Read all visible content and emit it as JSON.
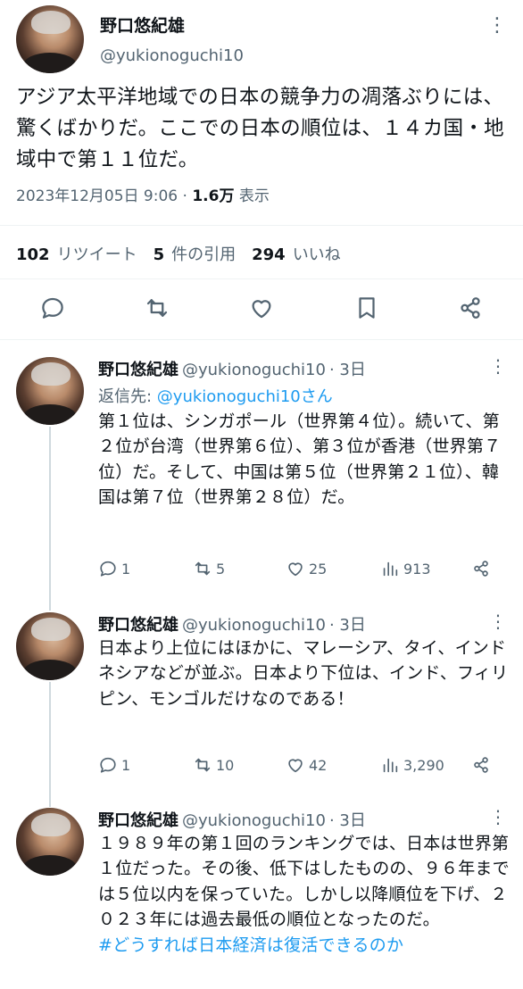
{
  "main": {
    "name": "野口悠紀雄",
    "handle": "@yukionoguchi10",
    "text": "アジア太平洋地域での日本の競争力の凋落ぶりには、驚くばかりだ。ここでの日本の順位は、１４カ国・地域中で第１１位だ。",
    "timestamp": "2023年12月05日 9:06",
    "separator": "·",
    "views_count": "1.6万",
    "views_label": "表示",
    "retweets": {
      "count": "102",
      "label": "リツイート"
    },
    "quotes": {
      "count": "5",
      "label": "件の引用"
    },
    "likes": {
      "count": "294",
      "label": "いいね"
    }
  },
  "replies": [
    {
      "name": "野口悠紀雄",
      "handle": "@yukionoguchi10",
      "time": "· 3日",
      "reply_to_prefix": "返信先: ",
      "reply_to_handle": "@yukionoguchi10さん",
      "text": "第１位は、シンガポール（世界第４位）。続いて、第２位が台湾（世界第６位）、第３位が香港（世界第７位）だ。そして、中国は第５位（世界第２１位）、韓国は第７位（世界第２８位）だ。",
      "reply_count": "1",
      "retweet_count": "5",
      "like_count": "25",
      "view_count": "913"
    },
    {
      "name": "野口悠紀雄",
      "handle": "@yukionoguchi10",
      "time": "· 3日",
      "text": "日本より上位にはほかに、マレーシア、タイ、インドネシアなどが並ぶ。日本より下位は、インド、フィリピン、モンゴルだけなのである！",
      "reply_count": "1",
      "retweet_count": "10",
      "like_count": "42",
      "view_count": "3,290"
    },
    {
      "name": "野口悠紀雄",
      "handle": "@yukionoguchi10",
      "time": "· 3日",
      "text": "１９８９年の第１回のランキングでは、日本は世界第１位だった。その後、低下はしたものの、９６年までは５位以内を保っていた。しかし以降順位を下げ、２０２３年には過去最低の順位となったのだ。",
      "hashtag": "#どうすれば日本経済は復活できるのか"
    }
  ],
  "more_icon": "⋮",
  "colors": {
    "accent": "#1d9bf0",
    "muted": "#536471",
    "text": "#0f1419"
  }
}
